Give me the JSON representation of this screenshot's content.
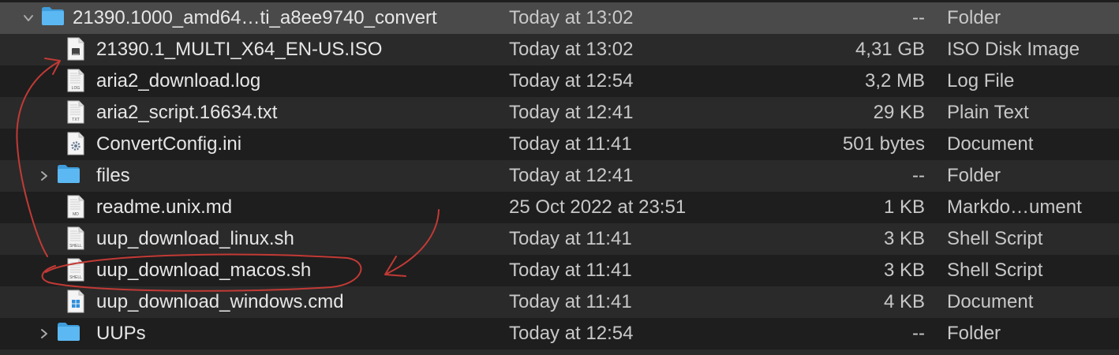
{
  "rows": [
    {
      "id": "root",
      "name": "21390.1000_amd64…ti_a8ee9740_convert",
      "date": "Today at 13:02",
      "size": "--",
      "kind": "Folder",
      "icon": "folder-icon",
      "type": "folder",
      "expanded": true,
      "level": 0
    },
    {
      "id": "iso",
      "name": "21390.1_MULTI_X64_EN-US.ISO",
      "date": "Today at 13:02",
      "size": "4,31 GB",
      "kind": "ISO Disk Image",
      "icon": "disk-image-icon",
      "type": "file",
      "level": 1
    },
    {
      "id": "log",
      "name": "aria2_download.log",
      "date": "Today at 12:54",
      "size": "3,2 MB",
      "kind": "Log File",
      "icon": "log-file-icon",
      "badge": "LOG",
      "type": "file",
      "level": 1
    },
    {
      "id": "txt",
      "name": "aria2_script.16634.txt",
      "date": "Today at 12:41",
      "size": "29 KB",
      "kind": "Plain Text",
      "icon": "text-file-icon",
      "badge": "TXT",
      "type": "file",
      "level": 1
    },
    {
      "id": "ini",
      "name": "ConvertConfig.ini",
      "date": "Today at 11:41",
      "size": "501 bytes",
      "kind": "Document",
      "icon": "gear-document-icon",
      "type": "file",
      "level": 1
    },
    {
      "id": "files",
      "name": "files",
      "date": "Today at 12:41",
      "size": "--",
      "kind": "Folder",
      "icon": "folder-icon",
      "type": "folder",
      "expanded": false,
      "level": 1
    },
    {
      "id": "readme",
      "name": "readme.unix.md",
      "date": "25 Oct 2022 at 23:51",
      "size": "1 KB",
      "kind": "Markdo…ument",
      "icon": "markdown-file-icon",
      "badge": "MD",
      "type": "file",
      "level": 1
    },
    {
      "id": "linux",
      "name": "uup_download_linux.sh",
      "date": "Today at 11:41",
      "size": "3 KB",
      "kind": "Shell Script",
      "icon": "shell-script-icon",
      "badge": "SHELL",
      "type": "file",
      "level": 1
    },
    {
      "id": "macos",
      "name": "uup_download_macos.sh",
      "date": "Today at 11:41",
      "size": "3 KB",
      "kind": "Shell Script",
      "icon": "shell-script-icon",
      "badge": "SHELL",
      "type": "file",
      "level": 1
    },
    {
      "id": "windows",
      "name": "uup_download_windows.cmd",
      "date": "Today at 11:41",
      "size": "4 KB",
      "kind": "Document",
      "icon": "windows-document-icon",
      "type": "file",
      "level": 1
    },
    {
      "id": "uups",
      "name": "UUPs",
      "date": "Today at 12:54",
      "size": "--",
      "kind": "Folder",
      "icon": "folder-icon",
      "type": "folder",
      "expanded": false,
      "level": 1
    }
  ],
  "colors": {
    "folder_blue": "#5cb8f2",
    "annotation_red": "#c23a35",
    "selected_row": "#4a4a4a",
    "alt_row": "#2a2a2a"
  }
}
